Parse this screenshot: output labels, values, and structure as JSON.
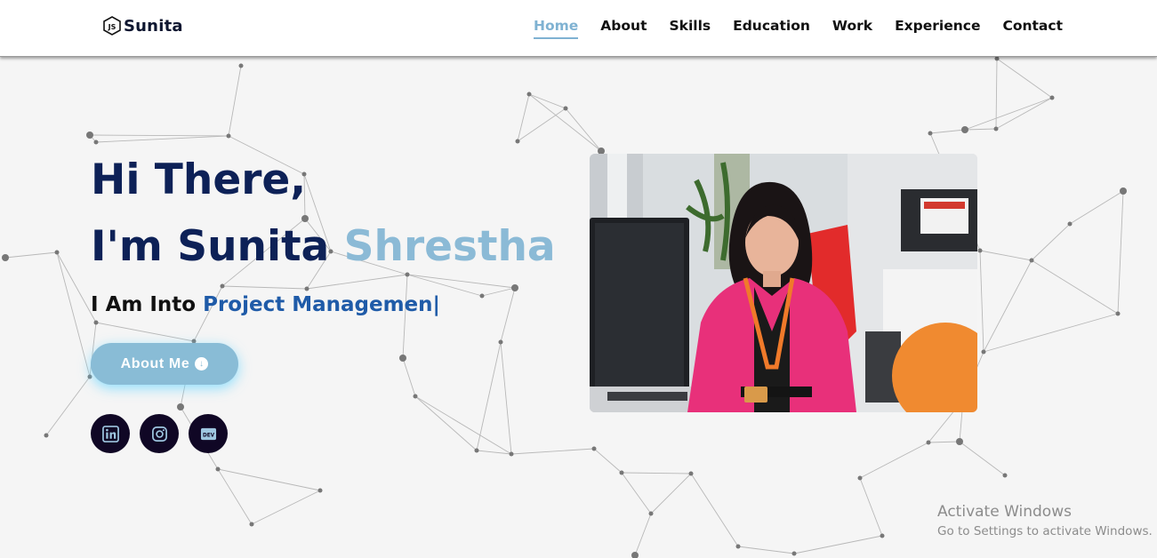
{
  "brand": {
    "name": "Sunita",
    "logo_icon": "js-hexagon-icon"
  },
  "nav": {
    "links": [
      {
        "label": "Home",
        "active": true
      },
      {
        "label": "About",
        "active": false
      },
      {
        "label": "Skills",
        "active": false
      },
      {
        "label": "Education",
        "active": false
      },
      {
        "label": "Work",
        "active": false
      },
      {
        "label": "Experience",
        "active": false
      },
      {
        "label": "Contact",
        "active": false
      }
    ]
  },
  "hero": {
    "greeting": "Hi There,",
    "intro_prefix": "I'm Sunita",
    "intro_last": "Shrestha",
    "into_prefix": "I Am Into",
    "into_role": "Project Managemen",
    "typing_cursor": "|",
    "about_button": "About Me",
    "about_button_icon": "arrow-down-circle-icon",
    "socials": [
      {
        "name": "linkedin",
        "icon": "linkedin-icon"
      },
      {
        "name": "instagram",
        "icon": "instagram-icon"
      },
      {
        "name": "dev",
        "icon": "dev-icon",
        "text": "DEV"
      }
    ],
    "photo_alt": "portrait-photo"
  },
  "colors": {
    "navy": "#0d2157",
    "accent": "#8bbad6",
    "role_blue": "#1f5ba8",
    "nav_active": "#7fb2d2",
    "social_bg": "#100725",
    "background": "#f5f5f5"
  },
  "watermark": {
    "title": "Activate Windows",
    "subtitle": "Go to Settings to activate Windows."
  }
}
